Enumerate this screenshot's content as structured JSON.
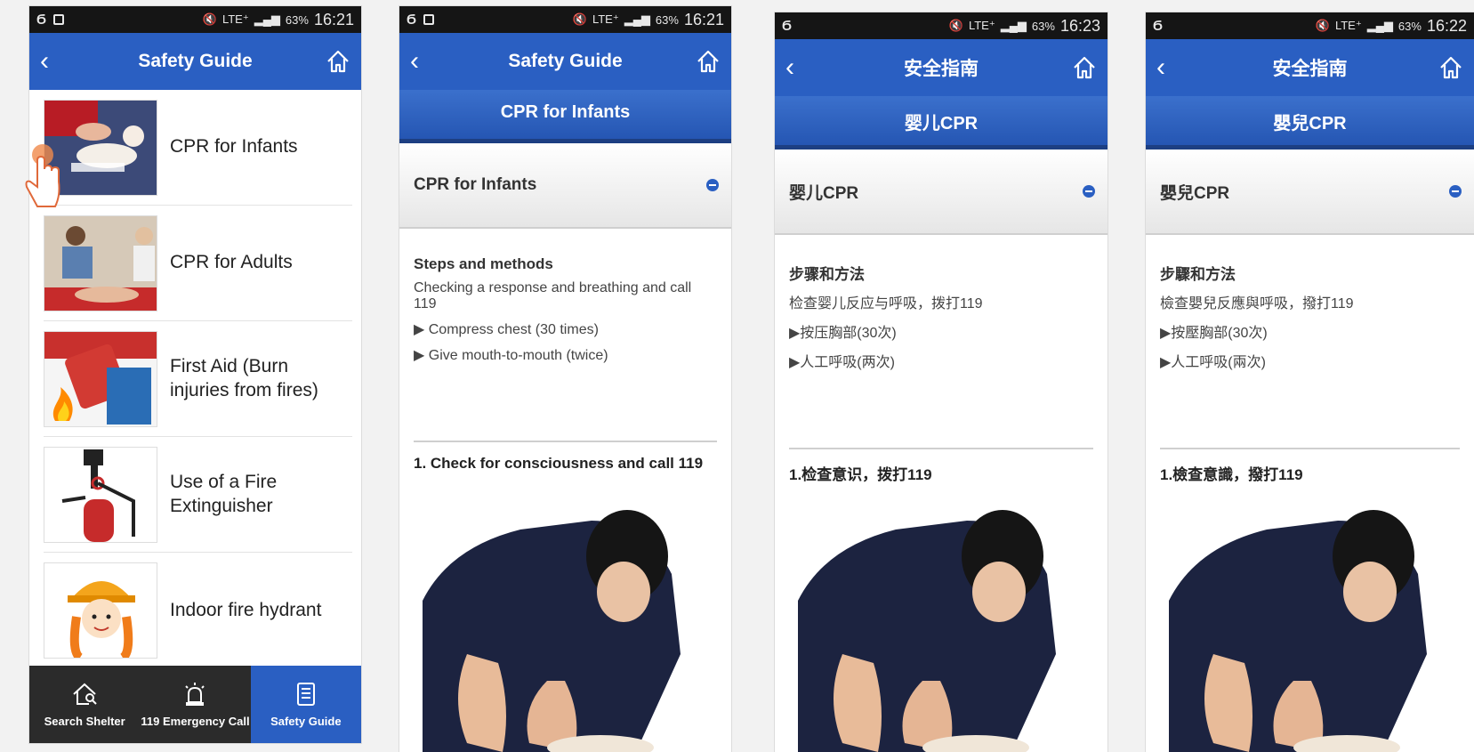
{
  "status": {
    "p1_time": "16:21",
    "p2_time": "16:21",
    "p3_time": "16:23",
    "p4_time": "16:22",
    "battery": "63%",
    "network": "LTE⁺"
  },
  "screen1": {
    "title": "Safety Guide",
    "items": [
      {
        "label": "CPR for Infants"
      },
      {
        "label": "CPR for Adults"
      },
      {
        "label": "First Aid (Burn injuries from fires)"
      },
      {
        "label": "Use of a Fire Extinguisher"
      },
      {
        "label": "Indoor fire hydrant"
      }
    ],
    "tabs": [
      {
        "label": "Search Shelter"
      },
      {
        "label": "119 Emergency Call"
      },
      {
        "label": "Safety Guide"
      }
    ]
  },
  "screen2": {
    "title": "Safety Guide",
    "subtitle": "CPR for Infants",
    "section": "CPR for Infants",
    "steps_title": "Steps and methods",
    "line1": "Checking a response and breathing and call 119",
    "line2": "▶ Compress chest (30 times)",
    "line3": "▶ Give mouth-to-mouth (twice)",
    "step1": "1. Check for consciousness and call 119"
  },
  "screen3": {
    "title": "安全指南",
    "subtitle": "婴儿CPR",
    "section": "婴儿CPR",
    "steps_title": "步骤和方法",
    "line1": "检查婴儿反应与呼吸，拨打119",
    "line2": "▶按压胸部(30次)",
    "line3": "▶人工呼吸(两次)",
    "step1": "1.检查意识，拨打119"
  },
  "screen4": {
    "title": "安全指南",
    "subtitle": "嬰兒CPR",
    "section": "嬰兒CPR",
    "steps_title": "步驟和方法",
    "line1": "檢查嬰兒反應與呼吸，撥打119",
    "line2": "▶按壓胸部(30次)",
    "line3": "▶人工呼吸(兩次)",
    "step1": "1.檢查意識，撥打119"
  },
  "colors": {
    "header_blue": "#2a5fc2",
    "tabbar_dark": "#2b2b2b",
    "statusbar": "#151515"
  }
}
